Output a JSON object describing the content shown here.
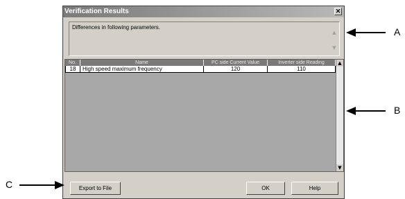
{
  "window": {
    "title": "Verification Results",
    "close_glyph": "✕"
  },
  "message": {
    "text": "Differences in following parameters."
  },
  "table": {
    "columns": [
      "No.",
      "Name",
      "PC side Current Value",
      "Inverter side Reading"
    ],
    "rows": [
      {
        "no": "18",
        "name": "High speed maximum frequency",
        "pc_value": "120",
        "inverter_value": "110"
      }
    ]
  },
  "buttons": {
    "export": "Export to File",
    "ok": "OK",
    "help": "Help"
  },
  "callouts": {
    "a": "A",
    "b": "B",
    "c": "C"
  },
  "icons": {
    "close": "close-icon",
    "scroll_up": "scroll-up-arrow-icon",
    "scroll_down": "scroll-down-arrow-icon"
  }
}
